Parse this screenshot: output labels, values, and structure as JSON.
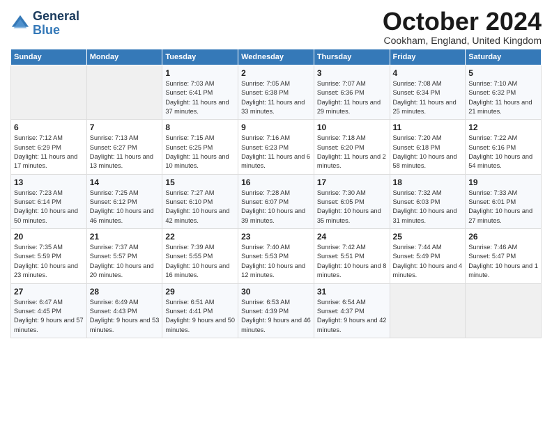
{
  "logo": {
    "line1": "General",
    "line2": "Blue"
  },
  "title": "October 2024",
  "location": "Cookham, England, United Kingdom",
  "days_of_week": [
    "Sunday",
    "Monday",
    "Tuesday",
    "Wednesday",
    "Thursday",
    "Friday",
    "Saturday"
  ],
  "weeks": [
    [
      {
        "day": "",
        "info": ""
      },
      {
        "day": "",
        "info": ""
      },
      {
        "day": "1",
        "info": "Sunrise: 7:03 AM\nSunset: 6:41 PM\nDaylight: 11 hours and 37 minutes."
      },
      {
        "day": "2",
        "info": "Sunrise: 7:05 AM\nSunset: 6:38 PM\nDaylight: 11 hours and 33 minutes."
      },
      {
        "day": "3",
        "info": "Sunrise: 7:07 AM\nSunset: 6:36 PM\nDaylight: 11 hours and 29 minutes."
      },
      {
        "day": "4",
        "info": "Sunrise: 7:08 AM\nSunset: 6:34 PM\nDaylight: 11 hours and 25 minutes."
      },
      {
        "day": "5",
        "info": "Sunrise: 7:10 AM\nSunset: 6:32 PM\nDaylight: 11 hours and 21 minutes."
      }
    ],
    [
      {
        "day": "6",
        "info": "Sunrise: 7:12 AM\nSunset: 6:29 PM\nDaylight: 11 hours and 17 minutes."
      },
      {
        "day": "7",
        "info": "Sunrise: 7:13 AM\nSunset: 6:27 PM\nDaylight: 11 hours and 13 minutes."
      },
      {
        "day": "8",
        "info": "Sunrise: 7:15 AM\nSunset: 6:25 PM\nDaylight: 11 hours and 10 minutes."
      },
      {
        "day": "9",
        "info": "Sunrise: 7:16 AM\nSunset: 6:23 PM\nDaylight: 11 hours and 6 minutes."
      },
      {
        "day": "10",
        "info": "Sunrise: 7:18 AM\nSunset: 6:20 PM\nDaylight: 11 hours and 2 minutes."
      },
      {
        "day": "11",
        "info": "Sunrise: 7:20 AM\nSunset: 6:18 PM\nDaylight: 10 hours and 58 minutes."
      },
      {
        "day": "12",
        "info": "Sunrise: 7:22 AM\nSunset: 6:16 PM\nDaylight: 10 hours and 54 minutes."
      }
    ],
    [
      {
        "day": "13",
        "info": "Sunrise: 7:23 AM\nSunset: 6:14 PM\nDaylight: 10 hours and 50 minutes."
      },
      {
        "day": "14",
        "info": "Sunrise: 7:25 AM\nSunset: 6:12 PM\nDaylight: 10 hours and 46 minutes."
      },
      {
        "day": "15",
        "info": "Sunrise: 7:27 AM\nSunset: 6:10 PM\nDaylight: 10 hours and 42 minutes."
      },
      {
        "day": "16",
        "info": "Sunrise: 7:28 AM\nSunset: 6:07 PM\nDaylight: 10 hours and 39 minutes."
      },
      {
        "day": "17",
        "info": "Sunrise: 7:30 AM\nSunset: 6:05 PM\nDaylight: 10 hours and 35 minutes."
      },
      {
        "day": "18",
        "info": "Sunrise: 7:32 AM\nSunset: 6:03 PM\nDaylight: 10 hours and 31 minutes."
      },
      {
        "day": "19",
        "info": "Sunrise: 7:33 AM\nSunset: 6:01 PM\nDaylight: 10 hours and 27 minutes."
      }
    ],
    [
      {
        "day": "20",
        "info": "Sunrise: 7:35 AM\nSunset: 5:59 PM\nDaylight: 10 hours and 23 minutes."
      },
      {
        "day": "21",
        "info": "Sunrise: 7:37 AM\nSunset: 5:57 PM\nDaylight: 10 hours and 20 minutes."
      },
      {
        "day": "22",
        "info": "Sunrise: 7:39 AM\nSunset: 5:55 PM\nDaylight: 10 hours and 16 minutes."
      },
      {
        "day": "23",
        "info": "Sunrise: 7:40 AM\nSunset: 5:53 PM\nDaylight: 10 hours and 12 minutes."
      },
      {
        "day": "24",
        "info": "Sunrise: 7:42 AM\nSunset: 5:51 PM\nDaylight: 10 hours and 8 minutes."
      },
      {
        "day": "25",
        "info": "Sunrise: 7:44 AM\nSunset: 5:49 PM\nDaylight: 10 hours and 4 minutes."
      },
      {
        "day": "26",
        "info": "Sunrise: 7:46 AM\nSunset: 5:47 PM\nDaylight: 10 hours and 1 minute."
      }
    ],
    [
      {
        "day": "27",
        "info": "Sunrise: 6:47 AM\nSunset: 4:45 PM\nDaylight: 9 hours and 57 minutes."
      },
      {
        "day": "28",
        "info": "Sunrise: 6:49 AM\nSunset: 4:43 PM\nDaylight: 9 hours and 53 minutes."
      },
      {
        "day": "29",
        "info": "Sunrise: 6:51 AM\nSunset: 4:41 PM\nDaylight: 9 hours and 50 minutes."
      },
      {
        "day": "30",
        "info": "Sunrise: 6:53 AM\nSunset: 4:39 PM\nDaylight: 9 hours and 46 minutes."
      },
      {
        "day": "31",
        "info": "Sunrise: 6:54 AM\nSunset: 4:37 PM\nDaylight: 9 hours and 42 minutes."
      },
      {
        "day": "",
        "info": ""
      },
      {
        "day": "",
        "info": ""
      }
    ]
  ]
}
